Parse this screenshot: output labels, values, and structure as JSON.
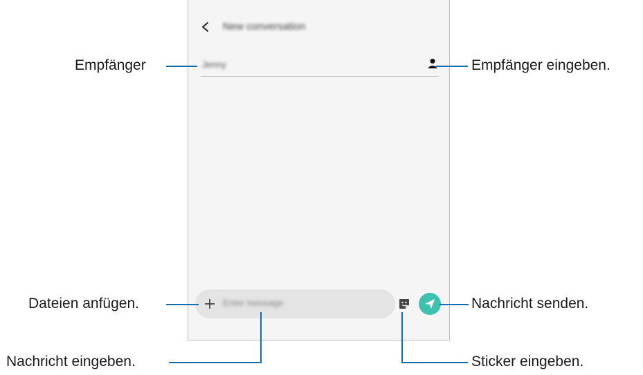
{
  "screen": {
    "title": "New conversation",
    "recipient_value": "Jenny",
    "message_placeholder": "Enter message"
  },
  "callouts": {
    "recipient": "Empfänger",
    "enter_recipient": "Empfänger eingeben.",
    "attach_files": "Dateien anfügen.",
    "send_message": "Nachricht senden.",
    "enter_message": "Nachricht eingeben.",
    "enter_sticker": "Sticker eingeben."
  },
  "colors": {
    "callout_line": "#0f6fb0",
    "send_button": "#3fc1b0",
    "screen_bg": "#f5f5f5",
    "compose_bar": "#e4e4e4"
  },
  "icons": [
    "back-icon",
    "contact-icon",
    "add-icon",
    "sticker-icon",
    "send-icon"
  ]
}
